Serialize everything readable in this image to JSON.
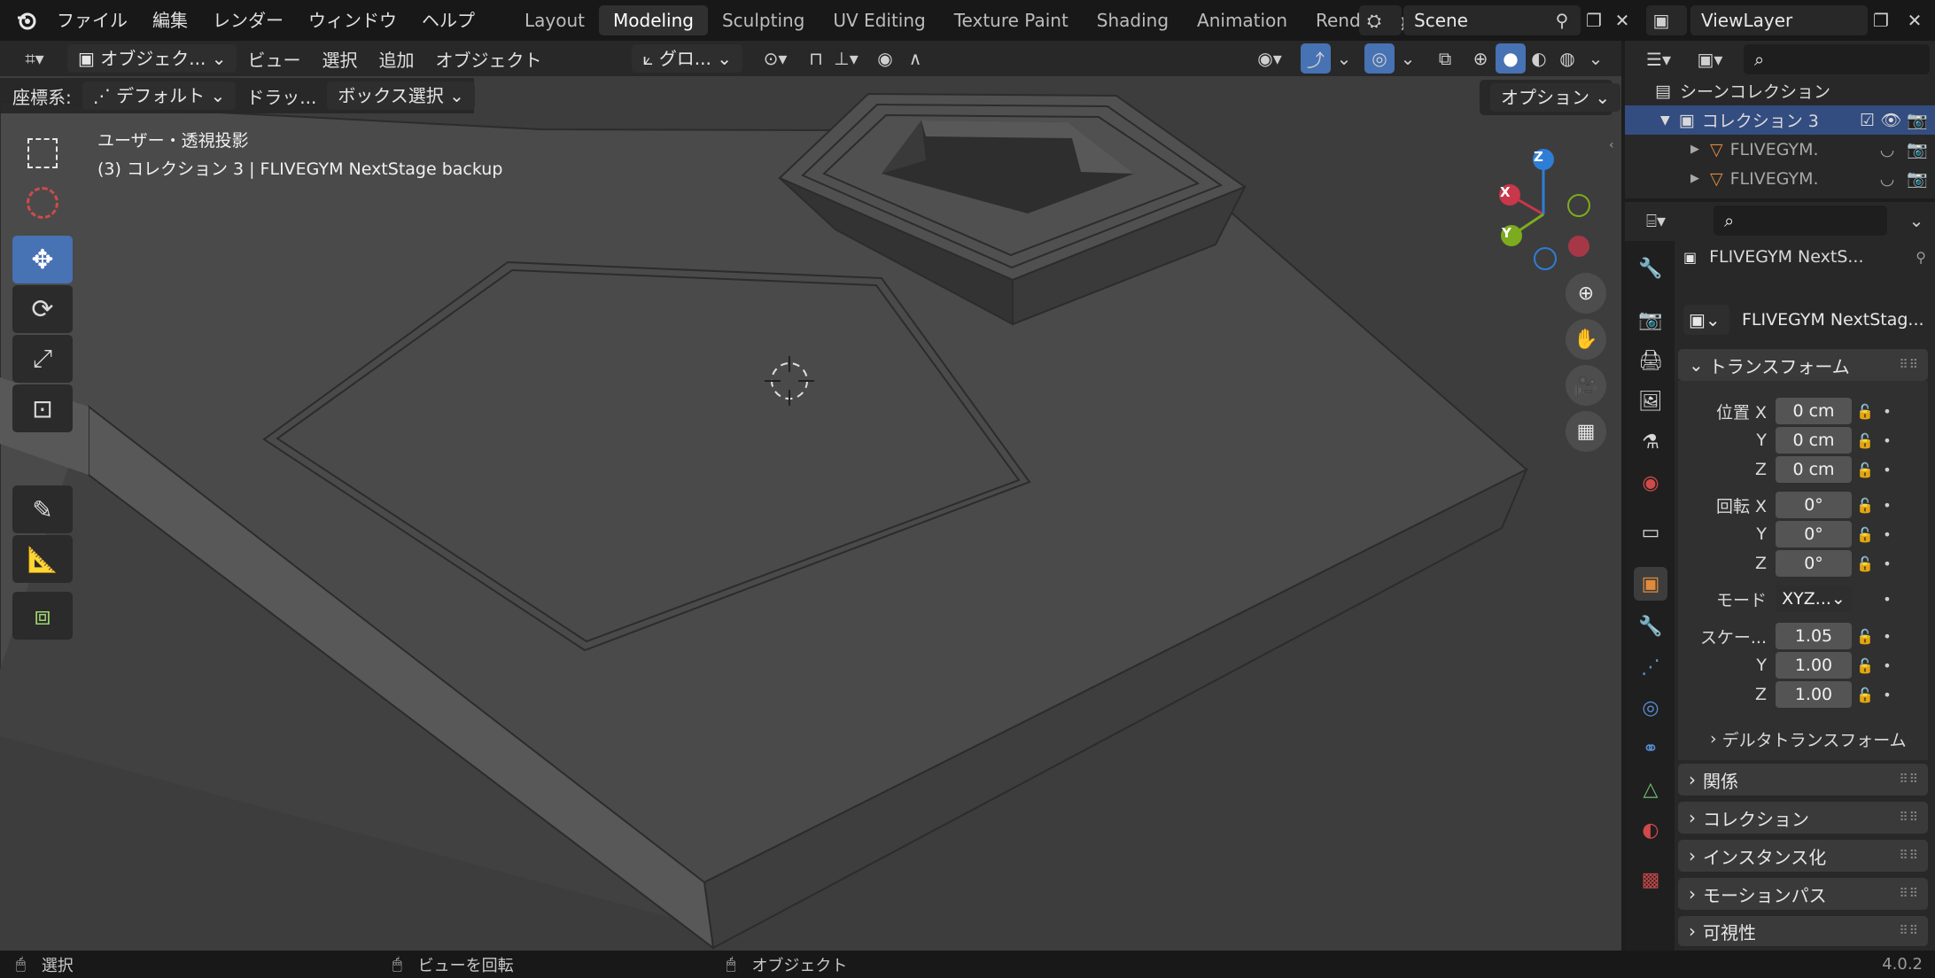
{
  "menubar": {
    "items": [
      "ファイル",
      "編集",
      "レンダー",
      "ウィンドウ",
      "ヘルプ"
    ]
  },
  "workspaces": {
    "tabs": [
      "Layout",
      "Modeling",
      "Sculpting",
      "UV Editing",
      "Texture Paint",
      "Shading",
      "Animation",
      "Rendering"
    ],
    "active": "Modeling"
  },
  "scene": {
    "name": "Scene"
  },
  "viewlayer": {
    "name": "ViewLayer"
  },
  "viewport_header": {
    "mode": "オブジェク...",
    "view": "ビュー",
    "select": "選択",
    "add": "追加",
    "object": "オブジェクト",
    "transform_orientation": "グロ..."
  },
  "tool_settings": {
    "coord_label": "座標系:",
    "coord_value": "デフォルト",
    "drag_label": "ドラッ...",
    "box_select": "ボックス選択",
    "options": "オプション"
  },
  "viewport_overlay": {
    "projection": "ユーザー・透視投影",
    "context": "(3) コレクション 3 | FLIVEGYM NextStage backup"
  },
  "gizmo": {
    "x": "X",
    "y": "Y",
    "z": "Z"
  },
  "outliner": {
    "scene_collection": "シーンコレクション",
    "collection": "コレクション 3",
    "objects": [
      "FLIVEGYM.",
      "FLIVEGYM."
    ]
  },
  "properties": {
    "object_name": "FLIVEGYM NextS...",
    "datablock_name": "FLIVEGYM NextStag...",
    "transform_header": "トランスフォーム",
    "location_label": "位置 X",
    "rotation_label": "回転 X",
    "scale_label": "スケー...",
    "axis_y": "Y",
    "axis_z": "Z",
    "location": [
      "0 cm",
      "0 cm",
      "0 cm"
    ],
    "rotation": [
      "0°",
      "0°",
      "0°"
    ],
    "mode_label": "モード",
    "mode_value": "XYZ...",
    "scale": [
      "1.05",
      "1.00",
      "1.00"
    ],
    "delta_transform": "デルタトランスフォーム",
    "panels": [
      "関係",
      "コレクション",
      "インスタンス化",
      "モーションパス",
      "可視性"
    ]
  },
  "statusbar": {
    "select": "選択",
    "rotate_view": "ビューを回転",
    "object": "オブジェクト",
    "version": "4.0.2"
  },
  "colors": {
    "accent": "#4772b3",
    "axis_x": "#c8374a",
    "axis_y": "#7dab1f",
    "axis_z": "#2e7dd6"
  }
}
